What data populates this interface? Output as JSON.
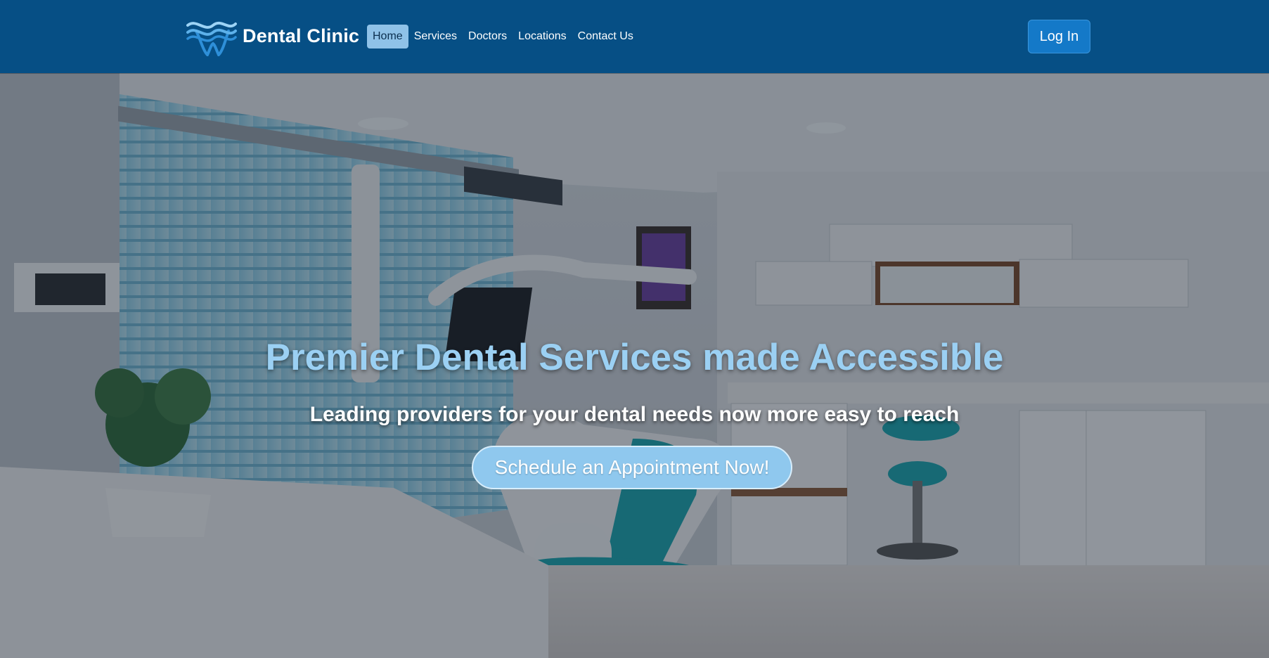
{
  "brand": {
    "name": "Dental Clinic",
    "logo_icon": "tooth-waves-icon"
  },
  "nav": {
    "items": [
      {
        "label": "Home",
        "active": true
      },
      {
        "label": "Services",
        "active": false
      },
      {
        "label": "Doctors",
        "active": false
      },
      {
        "label": "Locations",
        "active": false
      },
      {
        "label": "Contact Us",
        "active": false
      }
    ]
  },
  "header": {
    "login_label": "Log In"
  },
  "hero": {
    "title": "Premier Dental Services made Accessible",
    "subtitle": "Leading providers for your dental needs now more easy to reach",
    "cta_label": "Schedule an Appointment Now!",
    "background": "dental-treatment-room-photo"
  },
  "colors": {
    "navbar": "#064f85",
    "active_nav_bg": "#8fc2e8",
    "login_button": "#1479c8",
    "hero_title": "#9bd0f3",
    "cta_button": "#8fc8ee"
  }
}
